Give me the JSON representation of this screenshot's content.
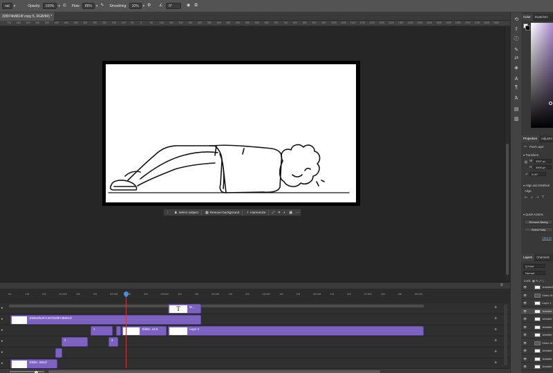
{
  "options_bar": {
    "mode_value": "nal",
    "opacity_label": "Opacity:",
    "opacity_value": "100%",
    "flow_label": "Flow:",
    "flow_value": "85%",
    "smoothing_label": "Smoothing:",
    "smoothing_value": "10%",
    "angle_value": "0°"
  },
  "document_tab": {
    "title": "33f974b8814f copy 5, RGB/8#) *"
  },
  "ruler": {
    "ticks": [
      "700",
      "650",
      "600",
      "550",
      "500",
      "450",
      "400",
      "350",
      "300",
      "250",
      "200",
      "150",
      "100",
      "50",
      "0",
      "50",
      "100",
      "150",
      "200",
      "250",
      "300",
      "350",
      "400",
      "450",
      "500",
      "550",
      "600",
      "650",
      "700",
      "750",
      "800",
      "850",
      "900",
      "950",
      "1000",
      "1050",
      "1100",
      "1150",
      "1200",
      "1250",
      "1300",
      "1350",
      "1400",
      "1450",
      "1500",
      "1550",
      "1600",
      "1650",
      "1700",
      "1750",
      "1800",
      "1850"
    ]
  },
  "context_bar": {
    "select_subject": "Select subject",
    "remove_background": "Remove background",
    "harmonize": "Harmonize",
    "more": "···"
  },
  "timeline": {
    "ticks": [
      "00",
      "10f",
      "20f",
      "01:00f",
      "10f",
      "20f",
      "02:00f",
      "10f",
      "20f",
      "03:00f",
      "10f",
      "20f",
      "04:00f",
      "10f",
      "20f",
      "05:00f",
      "10f",
      "20f",
      "06:00f",
      "10f",
      "20f",
      "07:00f",
      "10f",
      "20f",
      "08:00f"
    ],
    "clips": {
      "text_clip_label": "M...",
      "main_clip_label": "1bbb8ef52571497b33f974b8814f",
      "small_clip_label": "1bbb8...e5 5",
      "layer_clip_label": "Layer 3",
      "bottom_clip_label": "1bbb8...8814f",
      "text_thumb": "T",
      "clip_one_label": "1",
      "clip_two_label": "2",
      "clip_three_label": "3"
    }
  },
  "right_panels": {
    "color_tab": "Color",
    "swatches_tab": "Swatches",
    "properties_tab": "Properties",
    "adjustments_tab": "Adjustm",
    "pixel_layer": "Pixel Layer",
    "transform_header": "Transform",
    "w_label": "W",
    "w_value": "3307 px",
    "h_label": "H",
    "h_value": "3400 px",
    "angle_value": "0.00°",
    "align_header": "Align and Distributi",
    "align_label": "Align:",
    "quick_actions_header": "Quick Actions",
    "remove_bg_btn": "Remove Backg",
    "select_subject_btn": "Select Subj",
    "view_more": "View M",
    "layers_tab": "Layers",
    "channels_tab": "Channels",
    "kind_label": "Q Kind",
    "blend_mode": "Normal",
    "lock_label": "Lock:",
    "layers": [
      {
        "name": "1bbb8ef5",
        "type": "layer"
      },
      {
        "name": "Video Gro",
        "type": "folder"
      },
      {
        "name": "Layer 1",
        "type": "layer"
      },
      {
        "name": "1bbb8ef",
        "type": "layer"
      },
      {
        "name": "1bbb8ef",
        "type": "layer"
      },
      {
        "name": "1bbb8ef",
        "type": "layer"
      },
      {
        "name": "1bbb8ef",
        "type": "layer"
      },
      {
        "name": "Video Gro",
        "type": "folder"
      },
      {
        "name": "1bbb8ef",
        "type": "layer"
      },
      {
        "name": "1bbb8ef",
        "type": "layer"
      },
      {
        "name": "1bbb8ef",
        "type": "layer"
      }
    ]
  },
  "colors": {
    "clip_purple": "#7e62c0",
    "playhead_blue": "#4a90e2",
    "playhead_line": "#c03c3c",
    "color_picker_hue": "#b08ed6"
  },
  "icons": {
    "rtools": [
      "history-icon",
      "info-icon",
      "brush-icon",
      "adjust-icon",
      "layers-icon",
      "text-icon",
      "paragraph-icon",
      "glyph-icon",
      "document-icon",
      "export-icon"
    ]
  }
}
